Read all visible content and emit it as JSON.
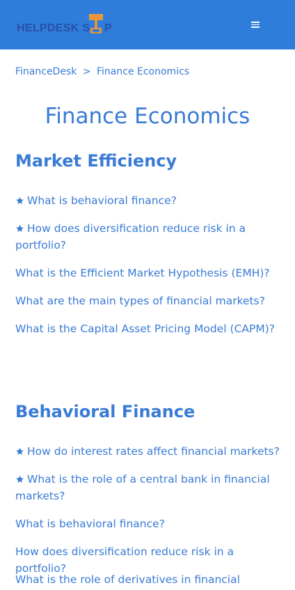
{
  "header": {
    "brand_text": "HELPDESK SHOP",
    "menu_icon": "hamburger-menu-icon",
    "colors": {
      "bar": "#2f7ddb",
      "logo_text": "#2a4fa8",
      "logo_icon": "#e8963a"
    }
  },
  "breadcrumb": {
    "root": "FinanceDesk",
    "separator": ">",
    "current": "Finance Economics"
  },
  "page": {
    "title": "Finance Economics"
  },
  "sections": [
    {
      "title": "Market Efficiency",
      "questions": [
        {
          "text": "What is behavioral finance?",
          "featured": true
        },
        {
          "text": "How does diversification reduce risk in a portfolio?",
          "featured": true
        },
        {
          "text": "What is the Efficient Market Hypothesis (EMH)?",
          "featured": false
        },
        {
          "text": "What are the main types of financial markets?",
          "featured": false
        },
        {
          "text": "What is the Capital Asset Pricing Model (CAPM)?",
          "featured": false
        }
      ]
    },
    {
      "title": "Behavioral Finance",
      "questions": [
        {
          "text": "How do interest rates affect financial markets?",
          "featured": true
        },
        {
          "text": "What is the role of a central bank in financial markets?",
          "featured": true
        },
        {
          "text": "What is behavioral finance?",
          "featured": false
        },
        {
          "text": "How does diversification reduce risk in a portfolio?",
          "featured": false
        },
        {
          "text": "What is the role of derivatives in financial",
          "featured": false
        }
      ]
    }
  ],
  "colors": {
    "link": "#3a7bd5",
    "star": "#3a7bd5"
  }
}
